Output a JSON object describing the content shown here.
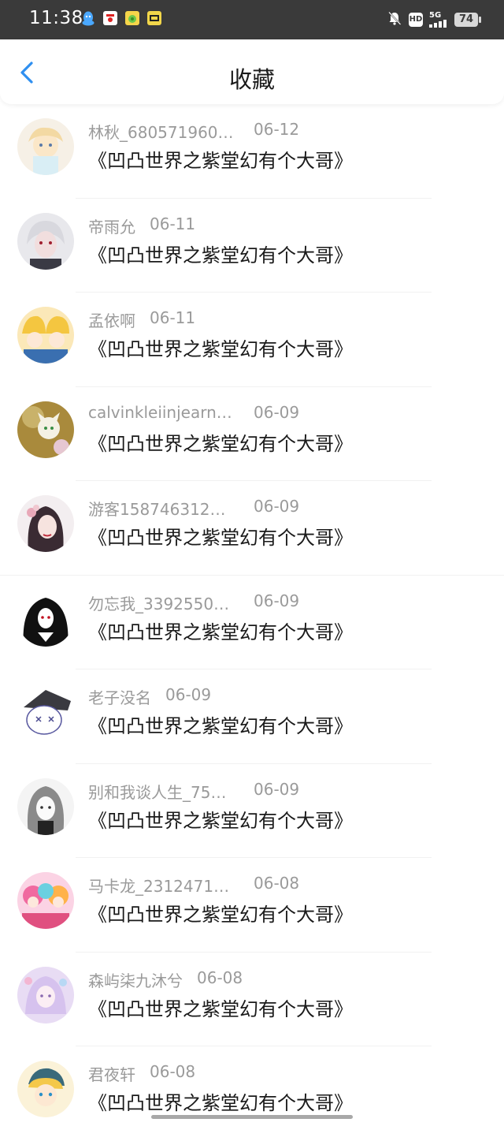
{
  "status_bar": {
    "time": "11:38",
    "battery": "74",
    "network": "5G",
    "hd": "HD",
    "app_icons": [
      "qq-icon",
      "kfc-icon",
      "pea-icon",
      "kuaikan-icon"
    ]
  },
  "header": {
    "title": "收藏",
    "back_icon": "chevron-left-icon",
    "accent": "#2f8ff0"
  },
  "items": [
    {
      "user": "林秋_680571960…",
      "date": "06-12",
      "book": "《凹凸世界之紫堂幻有个大哥》"
    },
    {
      "user": "帝雨允",
      "date": "06-11",
      "book": "《凹凸世界之紫堂幻有个大哥》"
    },
    {
      "user": "孟依啊",
      "date": "06-11",
      "book": "《凹凸世界之紫堂幻有个大哥》"
    },
    {
      "user": "calvinkleiinjearns…",
      "date": "06-09",
      "book": "《凹凸世界之紫堂幻有个大哥》"
    },
    {
      "user": "游客1587463126…",
      "date": "06-09",
      "book": "《凹凸世界之紫堂幻有个大哥》"
    },
    {
      "user": "勿忘我_3392550…",
      "date": "06-09",
      "book": "《凹凸世界之紫堂幻有个大哥》"
    },
    {
      "user": "老子没名",
      "date": "06-09",
      "book": "《凹凸世界之紫堂幻有个大哥》"
    },
    {
      "user": "别和我谈人生_75…",
      "date": "06-09",
      "book": "《凹凸世界之紫堂幻有个大哥》"
    },
    {
      "user": "马卡龙_2312471…",
      "date": "06-08",
      "book": "《凹凸世界之紫堂幻有个大哥》"
    },
    {
      "user": "森屿柒九沐兮",
      "date": "06-08",
      "book": "《凹凸世界之紫堂幻有个大哥》"
    },
    {
      "user": "君夜轩",
      "date": "06-08",
      "book": "《凹凸世界之紫堂幻有个大哥》"
    }
  ],
  "colors": {
    "meta_text": "#9a9a9a",
    "title_text": "#1a1a1a",
    "status_bar_bg": "#3a3a3a"
  }
}
